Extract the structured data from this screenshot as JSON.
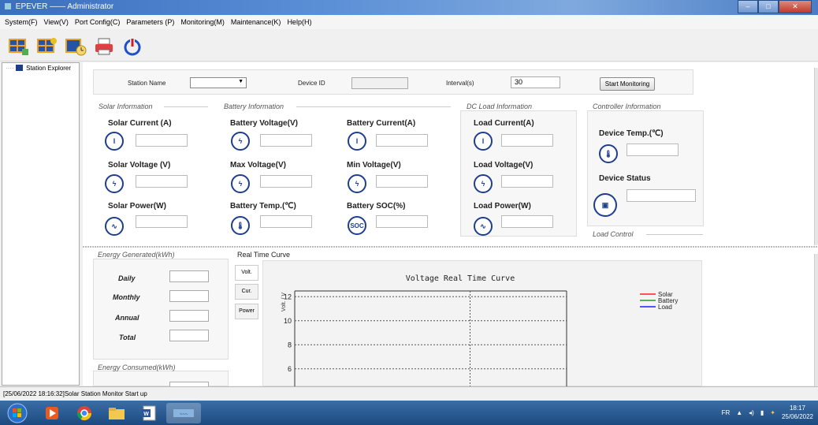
{
  "window": {
    "title": "EPEVER —— Administrator"
  },
  "menu": [
    "System(F)",
    "View(V)",
    "Port Config(C)",
    "Parameters (P)",
    "Monitoring(M)",
    "Maintenance(K)",
    "Help(H)"
  ],
  "toolbar_icons": [
    "solar-panel-icon",
    "solar-settings-icon",
    "solar-clock-icon",
    "printer-icon",
    "power-icon"
  ],
  "explorer": {
    "root_label": "Station Explorer"
  },
  "station": {
    "name_label": "Station Name",
    "name_value": "",
    "device_id_label": "Device ID",
    "device_id_value": "",
    "interval_label": "Interval(s)",
    "interval_value": "30",
    "start_button": "Start Monitoring"
  },
  "solar": {
    "title": "Solar Information",
    "current_label": "Solar Current (A)",
    "current_value": "",
    "voltage_label": "Solar Voltage (V)",
    "voltage_value": "",
    "power_label": "Solar Power(W)",
    "power_value": ""
  },
  "battery": {
    "title": "Battery Information",
    "voltage_label": "Battery Voltage(V)",
    "voltage_value": "",
    "current_label": "Battery Current(A)",
    "current_value": "",
    "max_voltage_label": "Max Voltage(V)",
    "max_voltage_value": "",
    "min_voltage_label": "Min Voltage(V)",
    "min_voltage_value": "",
    "temp_label": "Battery Temp.(℃)",
    "temp_value": "",
    "soc_label": "Battery SOC(%)",
    "soc_value": "",
    "soc_icon_text": "SOC"
  },
  "load": {
    "title": "DC Load Information",
    "current_label": "Load Current(A)",
    "current_value": "",
    "voltage_label": "Load Voltage(V)",
    "voltage_value": "",
    "power_label": "Load Power(W)",
    "power_value": ""
  },
  "controller": {
    "title": "Controller Information",
    "temp_label": "Device Temp.(℃)",
    "temp_value": "",
    "status_label": "Device Status",
    "status_value": "",
    "load_control_title": "Load Control"
  },
  "energy_generated": {
    "title": "Energy Generated(kWh)",
    "rows": [
      {
        "label": "Daily",
        "value": ""
      },
      {
        "label": "Monthly",
        "value": ""
      },
      {
        "label": "Annual",
        "value": ""
      },
      {
        "label": "Total",
        "value": ""
      }
    ]
  },
  "energy_consumed": {
    "title": "Energy Consumed(kWh)"
  },
  "curve": {
    "section_title": "Real Time Curve",
    "tabs": [
      "Volt.",
      "Cur.",
      "Power"
    ]
  },
  "chart_data": {
    "type": "line",
    "title": "Voltage Real Time Curve",
    "ylabel": "Volt. / V",
    "yticks": [
      12,
      10,
      8,
      6
    ],
    "ylim": [
      5,
      13
    ],
    "series": [
      {
        "name": "Solar",
        "color": "#ff2020",
        "values": []
      },
      {
        "name": "Battery",
        "color": "#20a020",
        "values": []
      },
      {
        "name": "Load",
        "color": "#2020ff",
        "values": []
      }
    ],
    "grid": true,
    "legend": "right"
  },
  "status": {
    "log": "[25/06/2022 18:16:32]Solar Station Monitor Start up"
  },
  "taskbar": {
    "lang": "FR",
    "time": "18:17",
    "date": "25/06/2022"
  }
}
